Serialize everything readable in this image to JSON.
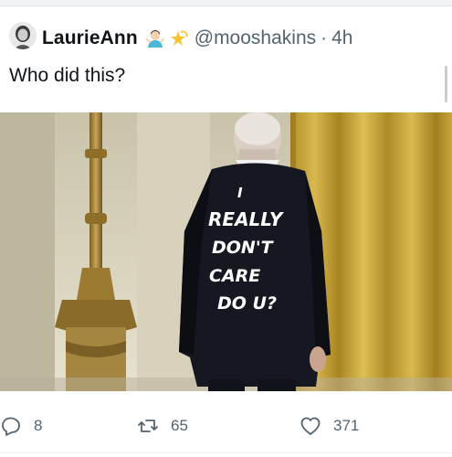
{
  "tweet": {
    "author": {
      "display_name": "LaurieAnn",
      "handle": "@mooshakins",
      "separator": "·",
      "time": "4h",
      "avatar_icon": "avatar-photo",
      "name_emojis": [
        "person-shrugging-emoji",
        "dizzy-star-emoji"
      ]
    },
    "text": "Who did this?",
    "media": {
      "jacket_text": [
        "I",
        "REALLY",
        "DON'T",
        "CARE",
        "DO U?"
      ]
    },
    "actions": {
      "reply_count": "8",
      "retweet_count": "65",
      "like_count": "371"
    }
  },
  "colors": {
    "text": "#0f1419",
    "secondary": "#536471",
    "curtain": "#c9a53a"
  }
}
